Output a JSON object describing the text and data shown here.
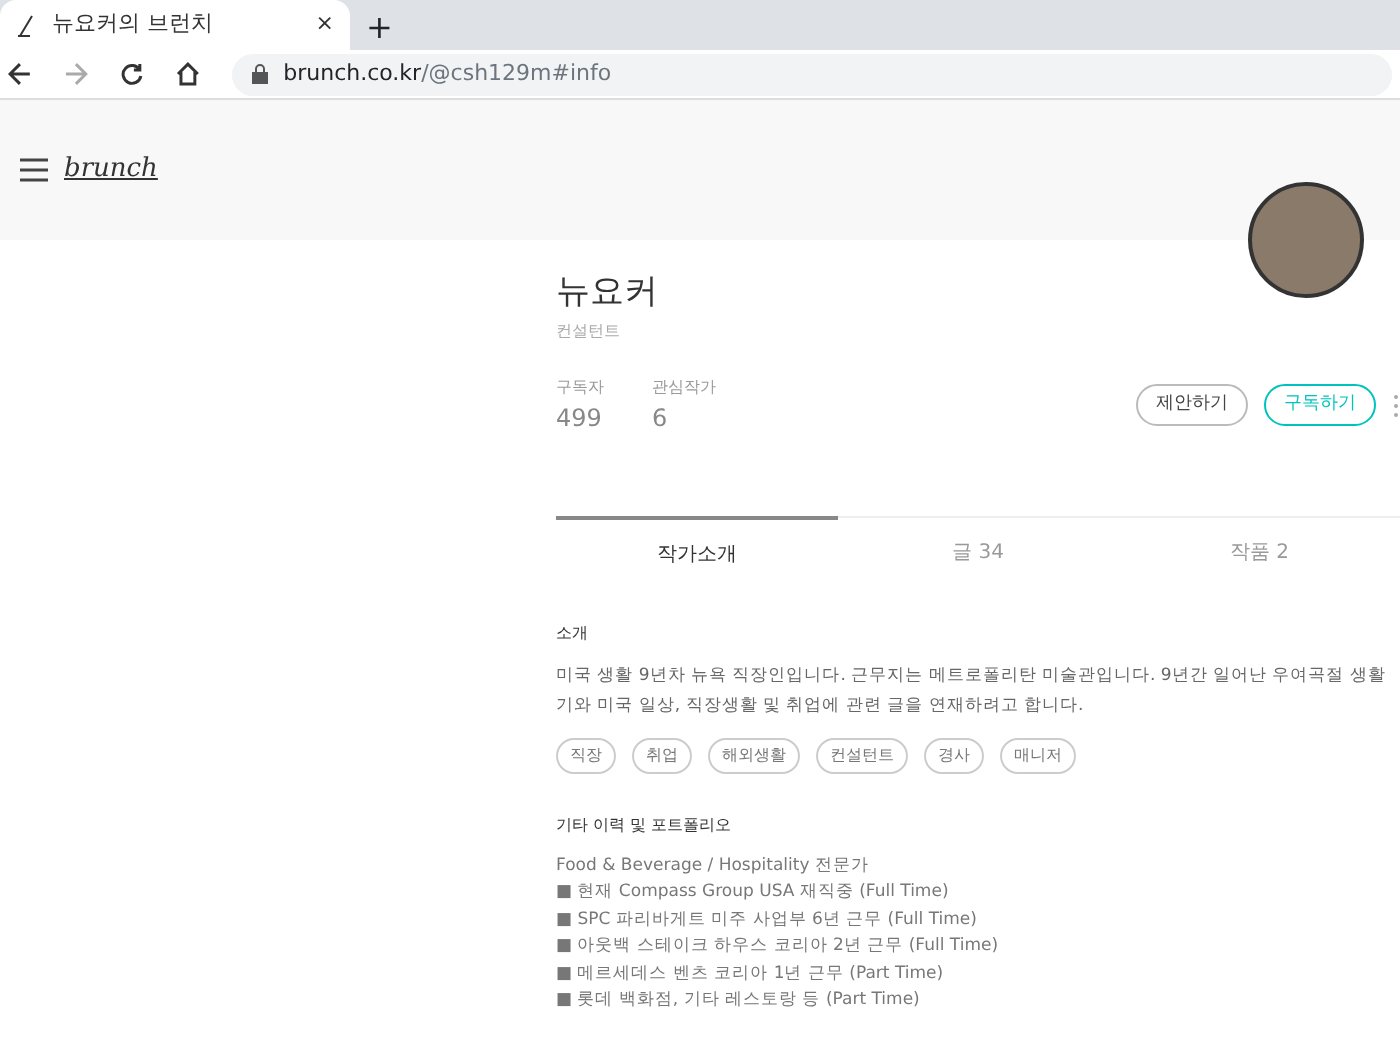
{
  "browser": {
    "tab_title": "뉴요커의 브런치",
    "tab_close": "×",
    "new_tab": "+",
    "url_host": "brunch.co.kr",
    "url_path": "/@csh129m#info"
  },
  "header": {
    "logo": "brunch"
  },
  "profile": {
    "name": "뉴요커",
    "role": "컨설턴트",
    "stats": [
      {
        "label": "구독자",
        "value": "499"
      },
      {
        "label": "관심작가",
        "value": "6"
      }
    ],
    "buttons": [
      {
        "label": "제안하기",
        "kind": "plain"
      },
      {
        "label": "구독하기",
        "kind": "accent"
      }
    ]
  },
  "tabs": [
    {
      "label": "작가소개",
      "selected": true
    },
    {
      "label": "글 34",
      "selected": false
    },
    {
      "label": "작품 2",
      "selected": false
    }
  ],
  "intro": {
    "heading": "소개",
    "text": "미국 생활 9년차 뉴욕 직장인입니다. 근무지는 메트로폴리탄 미술관입니다. 9년간 일어난 우여곡절 생활기와 미국 일상, 직장생활 및 취업에 관련 글을 연재하려고 합니다.",
    "tags": [
      "직장",
      "취업",
      "해외생활",
      "컨설턴트",
      "경사",
      "매니저"
    ]
  },
  "career": {
    "heading": "기타 이력 및 포트폴리오",
    "lines": [
      "Food & Beverage / Hospitality 전문가",
      "■ 현재 Compass Group USA 재직중 (Full Time)",
      "■ SPC 파리바게트 미주 사업부 6년 근무 (Full Time)",
      "■ 아웃백 스테이크 하우스 코리아 2년 근무 (Full Time)",
      "■ 메르세데스 벤츠 코리아 1년 근무 (Part Time)",
      "■ 롯데 백화점, 기타 레스토랑 등 (Part Time)"
    ]
  }
}
